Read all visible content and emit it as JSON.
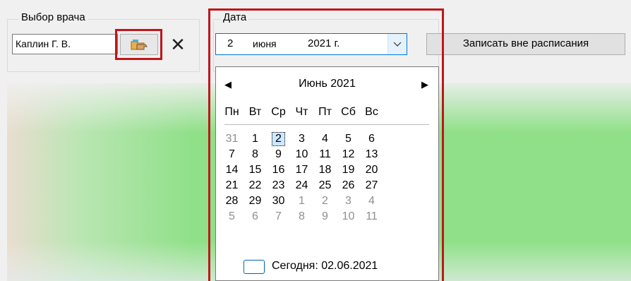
{
  "doctor_group": {
    "title": "Выбор врача",
    "doctor_value": "Каплин Г. В.",
    "pick_icon": "folder-hand-icon",
    "clear_symbol": "✕"
  },
  "date_group": {
    "title": "Дата",
    "day": "2",
    "month": "июня",
    "year": "2021 г.",
    "dropdown_symbol": "⌵"
  },
  "outside_button": {
    "label": "Записать вне расписания"
  },
  "calendar": {
    "prev_symbol": "◀",
    "next_symbol": "▶",
    "title": "Июнь 2021",
    "weekdays": [
      "Пн",
      "Вт",
      "Ср",
      "Чт",
      "Пт",
      "Сб",
      "Вс"
    ],
    "weeks": [
      [
        {
          "d": "31",
          "o": true
        },
        {
          "d": "1"
        },
        {
          "d": "2",
          "s": true
        },
        {
          "d": "3"
        },
        {
          "d": "4"
        },
        {
          "d": "5"
        },
        {
          "d": "6"
        }
      ],
      [
        {
          "d": "7"
        },
        {
          "d": "8"
        },
        {
          "d": "9"
        },
        {
          "d": "10"
        },
        {
          "d": "11"
        },
        {
          "d": "12"
        },
        {
          "d": "13"
        }
      ],
      [
        {
          "d": "14"
        },
        {
          "d": "15"
        },
        {
          "d": "16"
        },
        {
          "d": "17"
        },
        {
          "d": "18"
        },
        {
          "d": "19"
        },
        {
          "d": "20"
        }
      ],
      [
        {
          "d": "21"
        },
        {
          "d": "22"
        },
        {
          "d": "23"
        },
        {
          "d": "24"
        },
        {
          "d": "25"
        },
        {
          "d": "26"
        },
        {
          "d": "27"
        }
      ],
      [
        {
          "d": "28"
        },
        {
          "d": "29"
        },
        {
          "d": "30"
        },
        {
          "d": "1",
          "o": true
        },
        {
          "d": "2",
          "o": true
        },
        {
          "d": "3",
          "o": true
        },
        {
          "d": "4",
          "o": true
        }
      ],
      [
        {
          "d": "5",
          "o": true
        },
        {
          "d": "6",
          "o": true
        },
        {
          "d": "7",
          "o": true
        },
        {
          "d": "8",
          "o": true
        },
        {
          "d": "9",
          "o": true
        },
        {
          "d": "10",
          "o": true
        },
        {
          "d": "11",
          "o": true
        }
      ]
    ],
    "today_label": "Сегодня: 02.06.2021"
  },
  "colors": {
    "highlight_frame": "#c0161b",
    "accent": "#0078d7",
    "selected_day_bg": "#cce8ff",
    "panel_green": "#90e08a"
  }
}
